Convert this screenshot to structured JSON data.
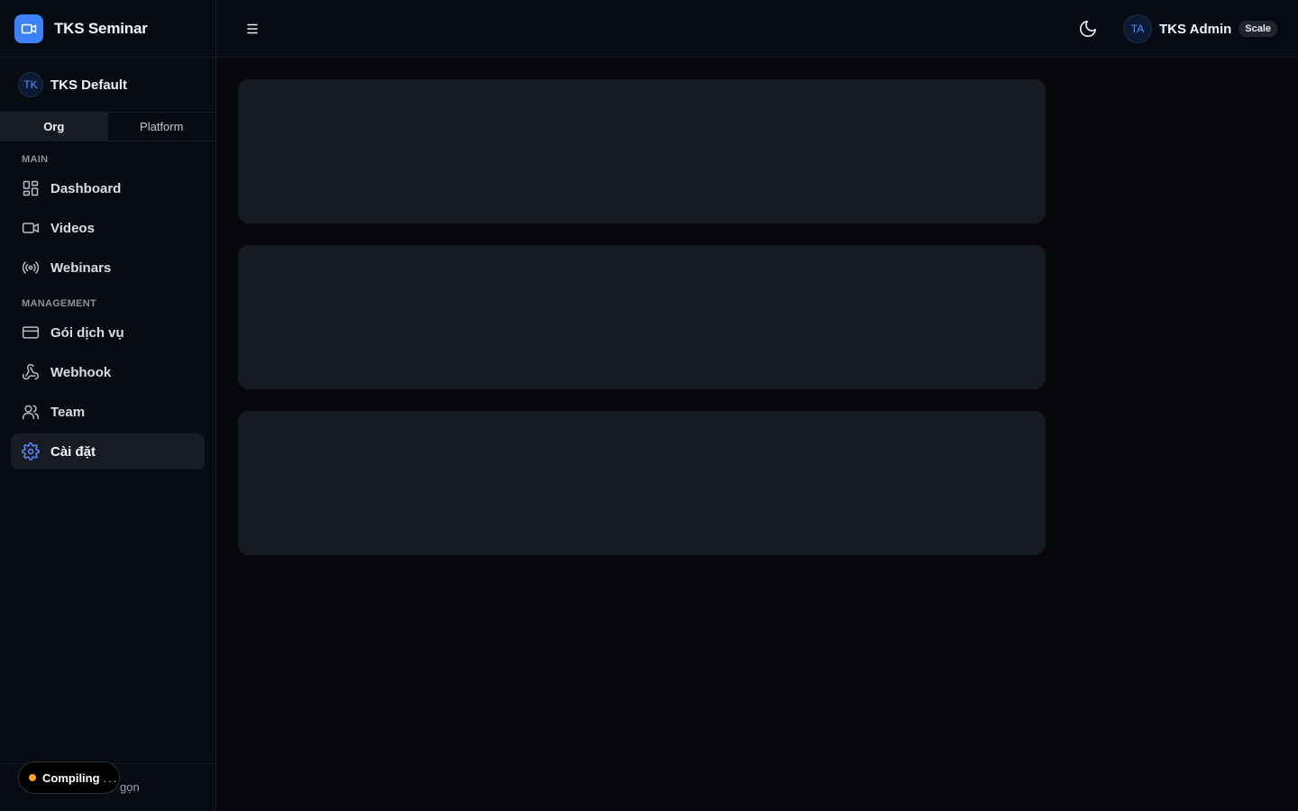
{
  "brand": {
    "name": "TKS Seminar",
    "icon": "video-camera-icon",
    "color": "#3b82f6"
  },
  "org": {
    "initials": "TK",
    "name": "TKS Default"
  },
  "tabs": [
    {
      "label": "Org",
      "active": true
    },
    {
      "label": "Platform",
      "active": false
    }
  ],
  "sections": {
    "main": {
      "label": "MAIN",
      "items": [
        {
          "label": "Dashboard",
          "icon": "grid-icon"
        },
        {
          "label": "Videos",
          "icon": "video-icon"
        },
        {
          "label": "Webinars",
          "icon": "broadcast-icon"
        }
      ]
    },
    "management": {
      "label": "MANAGEMENT",
      "items": [
        {
          "label": "Gói dịch vụ",
          "icon": "credit-card-icon"
        },
        {
          "label": "Webhook",
          "icon": "webhook-icon"
        },
        {
          "label": "Team",
          "icon": "users-icon"
        },
        {
          "label": "Cài đặt",
          "icon": "settings-icon",
          "active": true
        }
      ]
    }
  },
  "footer": {
    "collapse_label_visible": "gọn",
    "compiling_label": "Compiling",
    "compiling_dots": "..."
  },
  "header": {
    "menu_icon": "menu-icon",
    "theme_icon": "moon-icon",
    "user": {
      "initials": "TA",
      "name": "TKS Admin",
      "plan": "Scale"
    }
  },
  "accent_color": "#5b8cff",
  "status_color": "#f5a623"
}
